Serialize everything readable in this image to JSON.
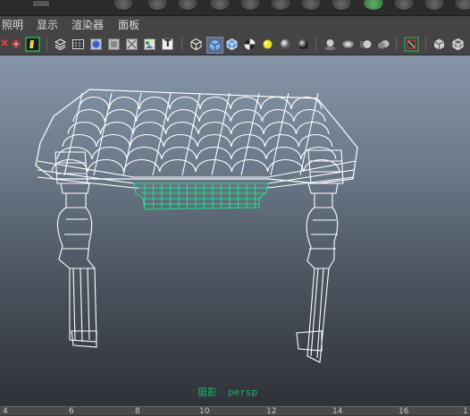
{
  "menubar": {
    "items": [
      "照明",
      "显示",
      "渲染器",
      "面板"
    ]
  },
  "toolbar": {
    "icons": [
      "select-camera-icon",
      "snap-icon",
      "isolate-icon",
      "wireframe-icon",
      "grid-icon",
      "smooth-shade-icon",
      "flat-shade-icon",
      "xray-icon",
      "texture-icon",
      "text-icon",
      "wire-cube-icon",
      "shaded-cube-icon",
      "wire-on-shaded-icon",
      "checker-icon",
      "light-icon",
      "sphere-icon",
      "sphere-dark-icon",
      "shadow-icon",
      "ambient-icon",
      "motion-blur-icon",
      "depth-icon",
      "resolution-gate-icon",
      "film-gate-icon",
      "cube-outline-icon"
    ],
    "text_icon_glyph": "T"
  },
  "viewport": {
    "camera_label": "persp",
    "camera_prefix": "摄影",
    "selection_color": "#22e08a",
    "wire_color": "#ffffff"
  },
  "timeslider": {
    "ticks": [
      "4",
      "6",
      "8",
      "10",
      "12",
      "14",
      "16",
      "1"
    ]
  }
}
